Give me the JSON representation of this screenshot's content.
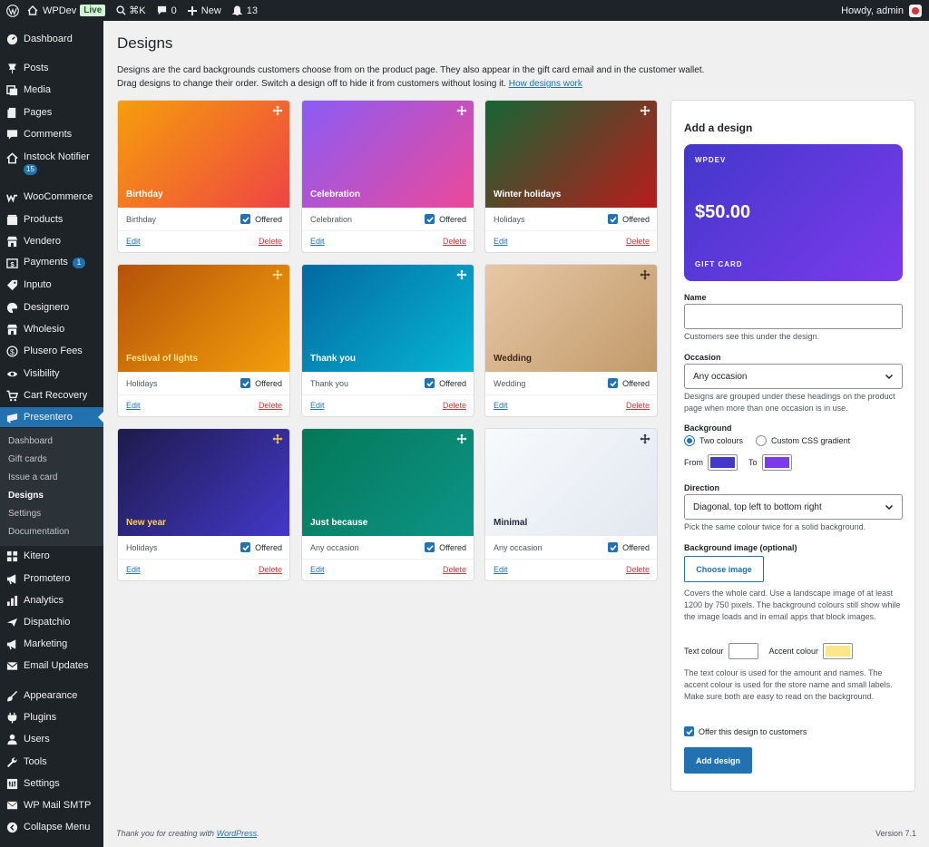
{
  "adminbar": {
    "site_name": "WPDev",
    "live_badge": "Live",
    "search_shortcut": "⌘K",
    "comments_count": "0",
    "new_label": "New",
    "notifications_count": "13",
    "howdy": "Howdy, admin"
  },
  "sidebar": {
    "items": [
      {
        "label": "Dashboard",
        "icon": "dashboard-icon"
      },
      {
        "label": "Posts",
        "icon": "pin-icon"
      },
      {
        "label": "Media",
        "icon": "media-icon"
      },
      {
        "label": "Pages",
        "icon": "pages-icon"
      },
      {
        "label": "Comments",
        "icon": "comment-icon"
      },
      {
        "label": "Instock Notifier",
        "icon": "home-icon",
        "badge": "15"
      },
      {
        "label": "WooCommerce",
        "icon": "woocommerce-icon"
      },
      {
        "label": "Products",
        "icon": "products-icon"
      },
      {
        "label": "Vendero",
        "icon": "store-icon"
      },
      {
        "label": "Payments",
        "icon": "payments-icon",
        "badge": "1"
      },
      {
        "label": "Inputo",
        "icon": "tag-icon"
      },
      {
        "label": "Designero",
        "icon": "palette-icon"
      },
      {
        "label": "Wholesio",
        "icon": "store-icon"
      },
      {
        "label": "Plusero Fees",
        "icon": "dollar-icon"
      },
      {
        "label": "Visibility",
        "icon": "eye-icon"
      },
      {
        "label": "Cart Recovery",
        "icon": "cart-icon"
      },
      {
        "label": "Presentero",
        "icon": "gift-icon"
      },
      {
        "label": "Kitero",
        "icon": "grid-icon"
      },
      {
        "label": "Promotero",
        "icon": "megaphone-icon"
      },
      {
        "label": "Analytics",
        "icon": "chart-icon"
      },
      {
        "label": "Dispatchio",
        "icon": "plane-icon"
      },
      {
        "label": "Marketing",
        "icon": "megaphone-icon"
      },
      {
        "label": "Email Updates",
        "icon": "email-icon"
      },
      {
        "label": "Appearance",
        "icon": "brush-icon"
      },
      {
        "label": "Plugins",
        "icon": "plugin-icon"
      },
      {
        "label": "Users",
        "icon": "user-icon"
      },
      {
        "label": "Tools",
        "icon": "wrench-icon"
      },
      {
        "label": "Settings",
        "icon": "settings-icon"
      },
      {
        "label": "WP Mail SMTP",
        "icon": "mail-icon"
      },
      {
        "label": "Collapse Menu",
        "icon": "collapse-icon"
      }
    ],
    "submenu": [
      "Dashboard",
      "Gift cards",
      "Issue a card",
      "Designs",
      "Settings",
      "Documentation"
    ]
  },
  "page": {
    "title": "Designs",
    "desc_line1": "Designs are the card backgrounds customers choose from on the product page. They also appear in the gift card email and in the customer wallet.",
    "desc_line2": "Drag designs to change their order. Switch a design off to hide it from customers without losing it.",
    "desc_link": "How designs work"
  },
  "cards": [
    {
      "name": "Birthday",
      "occasion": "Birthday",
      "offered": "Offered",
      "edit": "Edit",
      "delete": "Delete",
      "from": "#f59e0b",
      "to": "#ef4444",
      "text": "#ffffff",
      "drag": "#ffffff"
    },
    {
      "name": "Celebration",
      "occasion": "Celebration",
      "offered": "Offered",
      "edit": "Edit",
      "delete": "Delete",
      "from": "#8b5cf6",
      "to": "#ec4899",
      "text": "#ffffff",
      "drag": "#ffffff"
    },
    {
      "name": "Winter holidays",
      "occasion": "Holidays",
      "offered": "Offered",
      "edit": "Edit",
      "delete": "Delete",
      "from": "#166534",
      "to": "#b91c1c",
      "text": "#ffffff",
      "drag": "#ffffff"
    },
    {
      "name": "Festival of lights",
      "occasion": "Holidays",
      "offered": "Offered",
      "edit": "Edit",
      "delete": "Delete",
      "from": "#b45309",
      "to": "#f59e0b",
      "text": "#fde68a",
      "drag": "#fde68a"
    },
    {
      "name": "Thank you",
      "occasion": "Thank you",
      "offered": "Offered",
      "edit": "Edit",
      "delete": "Delete",
      "from": "#0369a1",
      "to": "#06b6d4",
      "text": "#ffffff",
      "drag": "#ffffff"
    },
    {
      "name": "Wedding",
      "occasion": "Wedding",
      "offered": "Offered",
      "edit": "Edit",
      "delete": "Delete",
      "from": "#e7c7a4",
      "to": "#c19a6b",
      "text": "#3f2a1a",
      "drag": "#3f2a1a"
    },
    {
      "name": "New year",
      "occasion": "Holidays",
      "offered": "Offered",
      "edit": "Edit",
      "delete": "Delete",
      "from": "#1e1b4b",
      "to": "#4338ca",
      "text": "#fcd34d",
      "drag": "#fcd34d"
    },
    {
      "name": "Just because",
      "occasion": "Any occasion",
      "offered": "Offered",
      "edit": "Edit",
      "delete": "Delete",
      "from": "#047857",
      "to": "#0d9488",
      "text": "#ffffff",
      "drag": "#ffffff"
    },
    {
      "name": "Minimal",
      "occasion": "Any occasion",
      "offered": "Offered",
      "edit": "Edit",
      "delete": "Delete",
      "from": "#f8fafc",
      "to": "#e2e8f0",
      "text": "#1e293b",
      "drag": "#1e293b"
    }
  ],
  "form": {
    "title": "Add a design",
    "preview_store": "WPDEV",
    "preview_amount": "$50.00",
    "preview_label": "GIFT CARD",
    "name_label": "Name",
    "name_value": "",
    "name_help": "Customers see this under the design.",
    "occasion_label": "Occasion",
    "occasion_value": "Any occasion",
    "occasion_help": "Designs are grouped under these headings on the product page when more than one occasion is in use.",
    "background_label": "Background",
    "radio_two": "Two colours",
    "radio_css": "Custom CSS gradient",
    "from_label": "From",
    "from_color": "#4338ca",
    "to_label": "To",
    "to_color": "#7c3aed",
    "direction_label": "Direction",
    "direction_value": "Diagonal, top left to bottom right",
    "direction_help": "Pick the same colour twice for a solid background.",
    "bgimage_label": "Background image (optional)",
    "choose_image": "Choose image",
    "bgimage_help": "Covers the whole card. Use a landscape image of at least 1200 by 750 pixels. The background colours still show while the image loads and in email apps that block images.",
    "text_colour_label": "Text colour",
    "text_colour": "#ffffff",
    "accent_colour_label": "Accent colour",
    "accent_colour": "#fde68a",
    "colour_help": "The text colour is used for the amount and names. The accent colour is used for the store name and small labels. Make sure both are easy to read on the background.",
    "offer_label": "Offer this design to customers",
    "submit": "Add design"
  },
  "footer": {
    "thanks_prefix": "Thank you for creating with",
    "thanks_link": "WordPress",
    "thanks_suffix": ".",
    "version": "Version 7.1"
  }
}
